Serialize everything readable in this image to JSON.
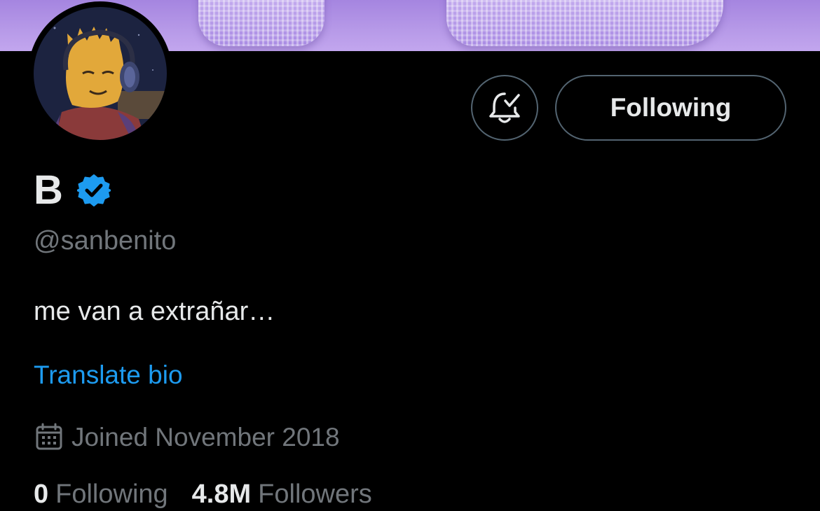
{
  "profile": {
    "display_name": "B",
    "handle": "@sanbenito",
    "bio": "me van a extrañar…",
    "translate_label": "Translate bio",
    "joined": "Joined November 2018",
    "verified": true
  },
  "actions": {
    "follow_label": "Following"
  },
  "stats": {
    "following_count": "0",
    "following_label": "Following",
    "followers_count": "4.8M",
    "followers_label": "Followers"
  },
  "icons": {
    "notifications": "bell-check-icon",
    "verified": "verified-badge-icon",
    "calendar": "calendar-icon"
  },
  "colors": {
    "background": "#000000",
    "text_primary": "#e7e9ea",
    "text_secondary": "#71767b",
    "link": "#1d9bf0",
    "verified": "#1d9bf0",
    "button_border": "#536471"
  }
}
